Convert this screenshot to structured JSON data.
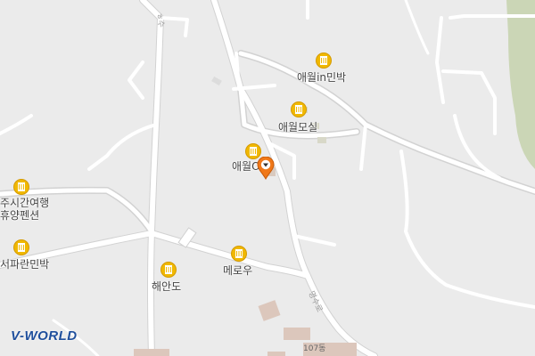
{
  "map": {
    "logo_text": "V-WORLD",
    "colors": {
      "background": "#ebebeb",
      "green_area": "#cbd6b6",
      "poi": "#f0b800",
      "marker": "#f07818",
      "logo": "#1f4f9c"
    },
    "pois": [
      {
        "label": "애월in민박",
        "icon": "lodging-icon"
      },
      {
        "label": "애월모실",
        "icon": "lodging-icon"
      },
      {
        "label": "애월O",
        "icon": "lodging-icon"
      },
      {
        "label": "주시간여행",
        "icon": "lodging-icon"
      },
      {
        "label": "휴양펜션",
        "icon": "lodging-icon"
      },
      {
        "label": "서파란민박",
        "icon": "lodging-icon"
      },
      {
        "label": "메로우",
        "icon": "lodging-icon"
      },
      {
        "label": "해안도",
        "icon": "lodging-icon"
      }
    ],
    "road_labels": [
      "ㅎ수",
      "명수로"
    ],
    "building_label": "107동",
    "marker": {
      "icon": "location-marker-icon",
      "color": "#f07818"
    }
  }
}
